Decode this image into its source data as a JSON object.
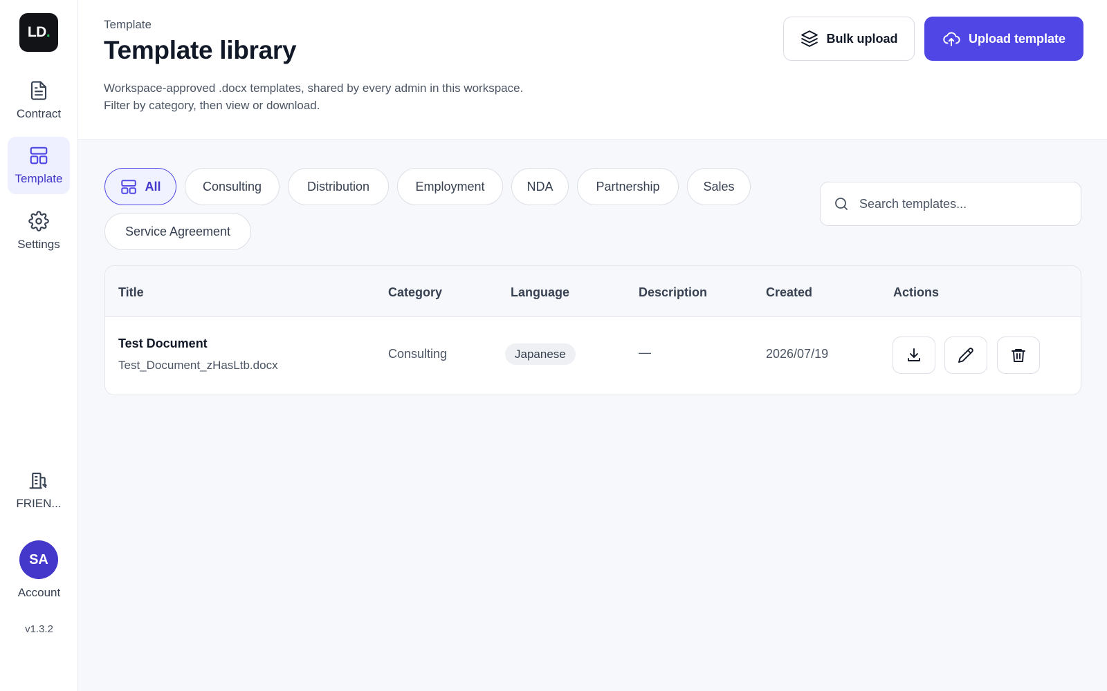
{
  "sidebar": {
    "logo_text": "LD",
    "logo_dot": ".",
    "items": [
      {
        "label": "Contract",
        "icon": "document-icon"
      },
      {
        "label": "Template",
        "icon": "layout-icon"
      },
      {
        "label": "Settings",
        "icon": "gear-icon"
      }
    ],
    "workspace": {
      "label": "FRIEN...",
      "icon": "building-icon"
    },
    "account": {
      "initials": "SA",
      "label": "Account"
    },
    "version": "v1.3.2"
  },
  "header": {
    "breadcrumb": "Template",
    "title": "Template library",
    "description_line1": "Workspace-approved .docx templates, shared by every admin in this workspace.",
    "description_line2": "Filter by category, then view or download.",
    "bulk_upload_label": "Bulk upload",
    "upload_label": "Upload template"
  },
  "filters": {
    "categories": [
      "All",
      "Consulting",
      "Distribution",
      "Employment",
      "NDA",
      "Partnership",
      "Sales",
      "Service Agreement"
    ],
    "selected": "All"
  },
  "search": {
    "placeholder": "Search templates...",
    "value": ""
  },
  "table": {
    "columns": [
      "Title",
      "Category",
      "Language",
      "Description",
      "Created",
      "Actions"
    ],
    "rows": [
      {
        "title": "Test Document",
        "file": "Test_Document_zHasLtb.docx",
        "category": "Consulting",
        "language": "Japanese",
        "description": "—",
        "created": "2026/07/19",
        "actions": [
          "download-icon",
          "pencil-icon",
          "trash-icon"
        ]
      }
    ]
  },
  "colors": {
    "accent": "#4f46e5",
    "logo_dot": "#22c55e"
  }
}
